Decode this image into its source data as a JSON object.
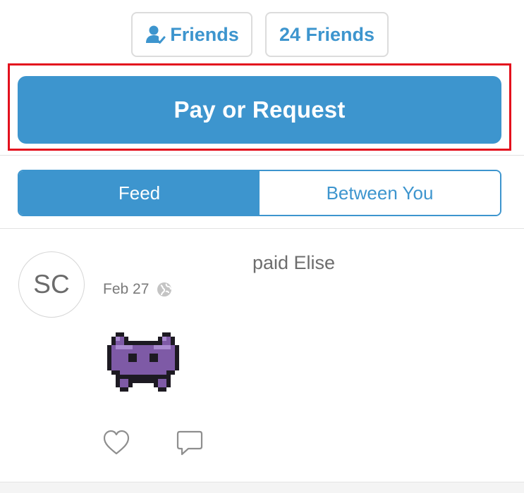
{
  "friends": {
    "friends_label": "Friends",
    "count_label": "24 Friends"
  },
  "actions": {
    "pay_request_label": "Pay or Request"
  },
  "tabs": [
    {
      "label": "Feed",
      "active": true
    },
    {
      "label": "Between You",
      "active": false
    }
  ],
  "feed": {
    "items": [
      {
        "avatar_initials": "SC",
        "story": "paid Elise",
        "date": "Feb 27",
        "privacy_icon": "globe-icon",
        "note_emoji": "alien-monster-emoji"
      }
    ]
  },
  "colors": {
    "accent": "#3d95ce",
    "highlight": "#e3101d"
  },
  "icons": [
    "friend-check-icon",
    "globe-icon",
    "heart-icon",
    "comment-icon"
  ]
}
